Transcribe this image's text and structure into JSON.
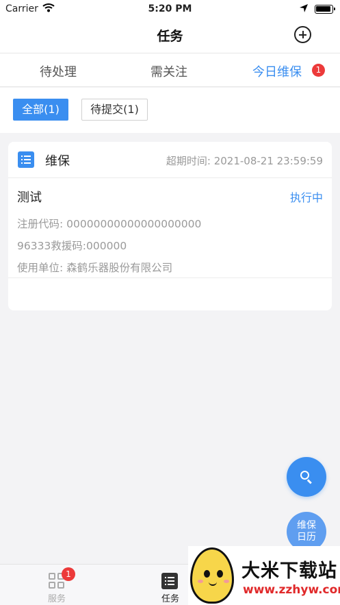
{
  "status_bar": {
    "carrier": "Carrier",
    "time": "5:20 PM"
  },
  "nav": {
    "title": "任务"
  },
  "tabs": [
    {
      "label": "待处理",
      "active": false
    },
    {
      "label": "需关注",
      "active": false
    },
    {
      "label": "今日维保",
      "active": true,
      "badge": "1"
    }
  ],
  "filters": [
    {
      "label": "全部(1)",
      "active": true
    },
    {
      "label": "待提交(1)",
      "active": false
    }
  ],
  "card": {
    "type": "维保",
    "overdue_label": "超期时间:",
    "overdue_time": "2021-08-21 23:59:59",
    "task_name": "测试",
    "status": "执行中",
    "registration_code": "注册代码: 00000000000000000000",
    "rescue_code": "96333救援码:000000",
    "unit": "使用单位: 森鹤乐器股份有限公司"
  },
  "fab": {
    "calendar_line1": "维保",
    "calendar_line2": "日历"
  },
  "tabbar": {
    "service_label": "服务",
    "service_badge": "1",
    "task_label": "任务"
  },
  "watermark": {
    "title": "大米下载站",
    "url": "www.zzhyw.com"
  },
  "colors": {
    "accent": "#3a8ef0",
    "badge": "#ec3a3a",
    "background": "#f3f3f5"
  }
}
